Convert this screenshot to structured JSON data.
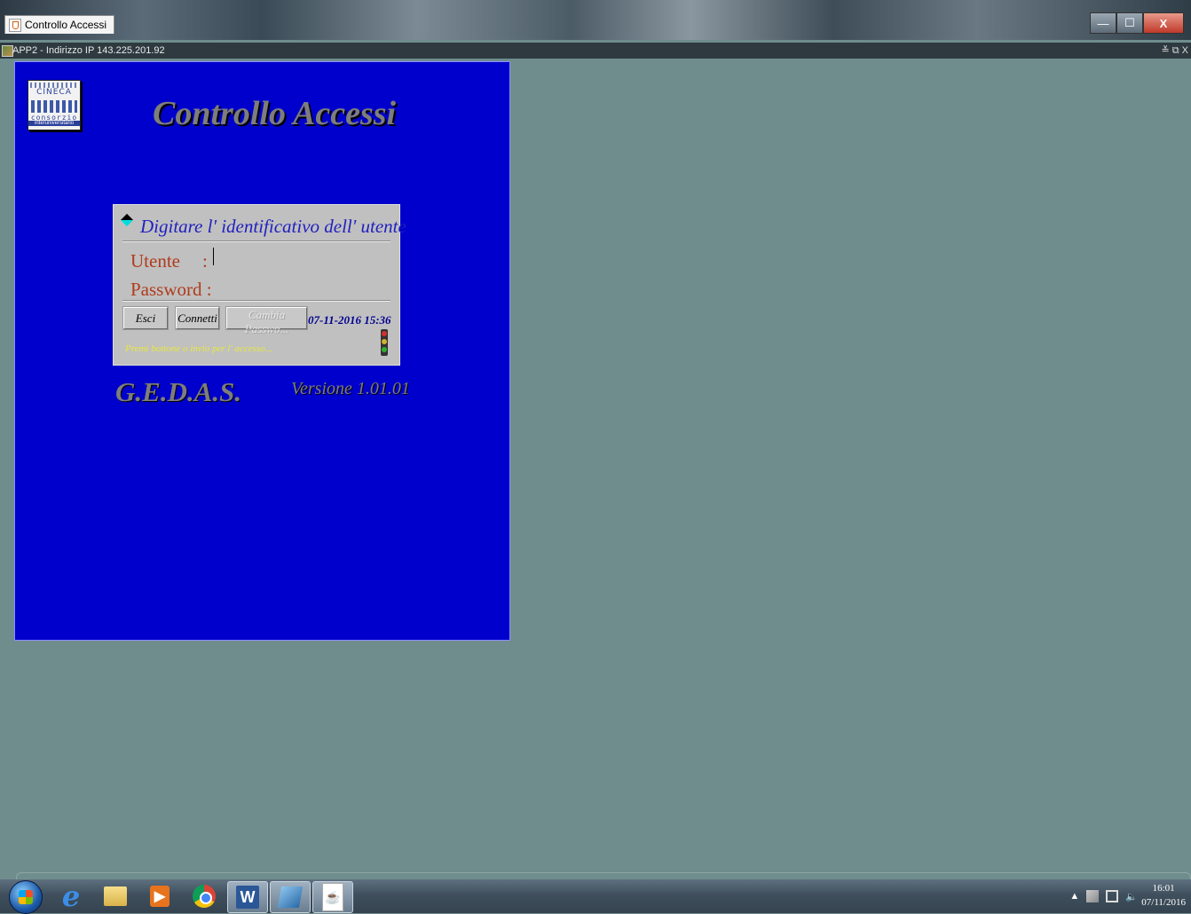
{
  "window": {
    "title": "Controllo Accessi",
    "minimize": "—",
    "maximize": "☐",
    "close": "X"
  },
  "frame": {
    "title": "APP2 - Indirizzo IP 143.225.201.92",
    "controls": "≚ ⧉ X"
  },
  "logo": {
    "name": "CINECA",
    "sub1": "consorzio",
    "sub2": "interuniversitario"
  },
  "app": {
    "title": "Controllo Accessi",
    "product": "G.E.D.A.S.",
    "version": "Versione 1.01.01"
  },
  "login": {
    "prompt": "Digitare l' identificativo dell' utente",
    "user_label": "Utente",
    "user_colon": ":",
    "user_value": "",
    "password_label": "Password :",
    "password_value": "",
    "buttons": {
      "esci": "Esci",
      "connetti": "Connetti",
      "cambia_password": "Cambia Passwo..."
    },
    "datetime": "07-11-2016 15:36",
    "hint": "Premi bottone o invio per l' accesso..."
  },
  "taskbar": {
    "items": [
      "start",
      "internet-explorer",
      "file-explorer",
      "media-player",
      "chrome",
      "word",
      "app",
      "java"
    ],
    "tray_arrow": "▲",
    "time": "16:01",
    "date": "07/11/2016"
  },
  "colors": {
    "desktop": "#6f8d8d",
    "panel": "#0000cc",
    "form": "#c0c0c0",
    "label": "#b03c1c",
    "prompt": "#2020c0"
  }
}
